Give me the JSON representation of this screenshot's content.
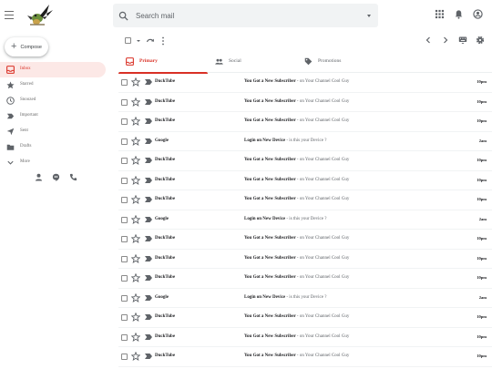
{
  "header": {
    "search_placeholder": "Search mail",
    "icons": [
      "menu-icon",
      "search-icon",
      "caret-down-icon",
      "apps-grid-icon",
      "bell-icon",
      "account-icon"
    ]
  },
  "sidebar": {
    "compose_label": "Compose",
    "items": [
      {
        "label": "Inbox",
        "icon": "inbox-icon",
        "active": true
      },
      {
        "label": "Starred",
        "icon": "star-icon",
        "active": false
      },
      {
        "label": "Snoozed",
        "icon": "clock-icon",
        "active": false
      },
      {
        "label": "Important",
        "icon": "label-important-icon",
        "active": false
      },
      {
        "label": "Sent",
        "icon": "send-icon",
        "active": false
      },
      {
        "label": "Drafts",
        "icon": "drafts-icon",
        "active": false
      },
      {
        "label": "More",
        "icon": "chevron-down-icon",
        "active": false
      }
    ],
    "tools": [
      "person-icon",
      "hangouts-icon",
      "phone-icon"
    ]
  },
  "tabs": [
    {
      "label": "Primary",
      "icon": "inbox-tab-icon",
      "active": true
    },
    {
      "label": "Social",
      "icon": "people-icon",
      "active": false
    },
    {
      "label": "Promotions",
      "icon": "tag-icon",
      "active": false
    }
  ],
  "colors": {
    "accent": "#d93025",
    "active_bg": "#fce8e6",
    "search_bg": "#f1f3f4"
  },
  "emails": [
    {
      "sender": "DuckTube",
      "subject": "You Got a New Subscriber",
      "snippet": " - on Your Channel Cool Guy",
      "time": "10pm"
    },
    {
      "sender": "DuckTube",
      "subject": "You Got a New Subscriber",
      "snippet": " - on Your Channel Cool Guy",
      "time": "10pm"
    },
    {
      "sender": "DuckTube",
      "subject": "You Got a New Subscriber",
      "snippet": " - on Your Channel Cool Guy",
      "time": "10pm"
    },
    {
      "sender": "Google",
      "subject": "Login on New Device",
      "snippet": " - is this your Device ?",
      "time": "2am"
    },
    {
      "sender": "DuckTube",
      "subject": "You Got a New Subscriber",
      "snippet": " - on Your Channel Cool Guy",
      "time": "10pm"
    },
    {
      "sender": "DuckTube",
      "subject": "You Got a New Subscriber",
      "snippet": " - on Your Channel Cool Guy",
      "time": "10pm"
    },
    {
      "sender": "DuckTube",
      "subject": "You Got a New Subscriber",
      "snippet": " - on Your Channel Cool Guy",
      "time": "10pm"
    },
    {
      "sender": "Google",
      "subject": "Login on New Device",
      "snippet": " - is this your Device ?",
      "time": "2am"
    },
    {
      "sender": "DuckTube",
      "subject": "You Got a New Subscriber",
      "snippet": " - on Your Channel Cool Guy",
      "time": "10pm"
    },
    {
      "sender": "DuckTube",
      "subject": "You Got a New Subscriber",
      "snippet": " - on Your Channel Cool Guy",
      "time": "10pm"
    },
    {
      "sender": "DuckTube",
      "subject": "You Got a New Subscriber",
      "snippet": " - on Your Channel Cool Guy",
      "time": "10pm"
    },
    {
      "sender": "Google",
      "subject": "Login on New Device",
      "snippet": " - is this your Device ?",
      "time": "2am"
    },
    {
      "sender": "DuckTube",
      "subject": "You Got a New Subscriber",
      "snippet": " - on Your Channel Cool Guy",
      "time": "10pm"
    },
    {
      "sender": "DuckTube",
      "subject": "You Got a New Subscriber",
      "snippet": " - on Your Channel Cool Guy",
      "time": "10pm"
    },
    {
      "sender": "DuckTube",
      "subject": "You Got a New Subscriber",
      "snippet": " - on Your Channel Cool Guy",
      "time": "10pm"
    }
  ]
}
